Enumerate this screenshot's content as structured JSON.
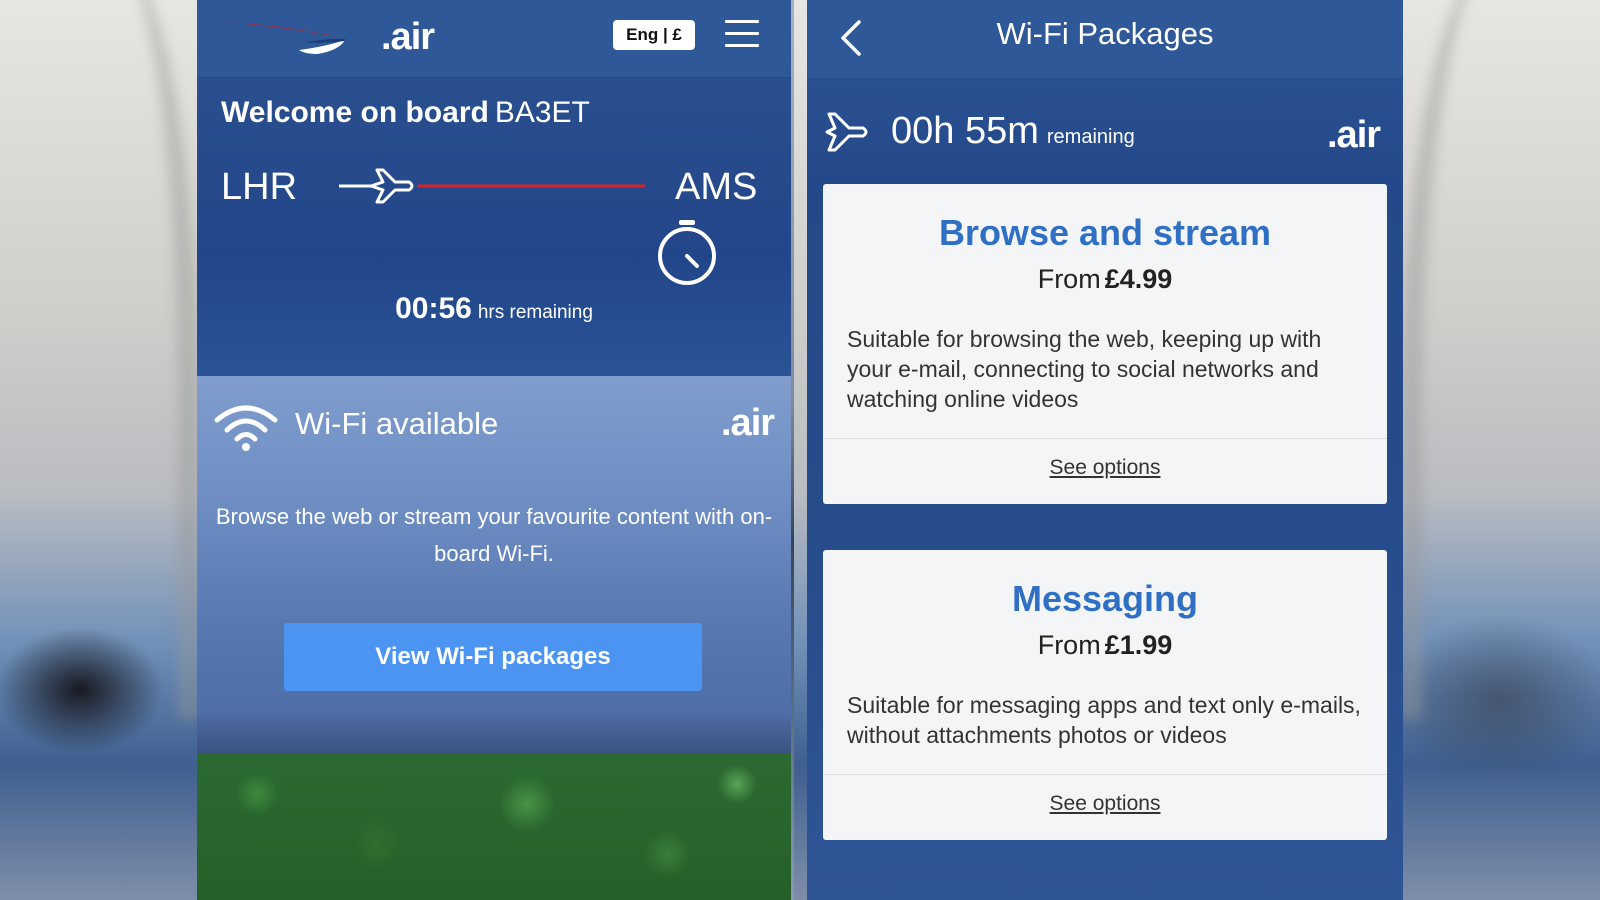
{
  "left_screen": {
    "brand": ".air",
    "language_currency": "Eng | £",
    "welcome_prefix": "Welcome on board",
    "flight_number": "BA3ET",
    "origin": "LHR",
    "destination": "AMS",
    "time_remaining": "00:56",
    "time_remaining_suffix": "hrs remaining",
    "wifi_status": "Wi-Fi available",
    "wifi_brand": ".air",
    "wifi_description": "Browse the web or stream your favourite content with on-board Wi-Fi.",
    "cta_label": "View Wi-Fi packages",
    "route_line_color": "#d8232a",
    "button_color": "#4b94f2"
  },
  "right_screen": {
    "title": "Wi-Fi Packages",
    "time_remaining": "00h 55m",
    "time_remaining_suffix": "remaining",
    "brand": ".air",
    "packages": [
      {
        "name": "Browse and stream",
        "price_prefix": "From",
        "price": "£4.99",
        "description": "Suitable for browsing the web, keeping up with your e-mail, connecting to social networks and watching online videos",
        "link_label": "See options"
      },
      {
        "name": "Messaging",
        "price_prefix": "From",
        "price": "£1.99",
        "description": "Suitable for messaging apps and text only e-mails, without attachments photos or videos",
        "link_label": "See options"
      }
    ],
    "title_color": "#2f6fc4"
  },
  "icons": [
    "ba-speedmarque-logo",
    "menu-icon",
    "plane-icon",
    "timer-icon",
    "wifi-icon",
    "back-icon"
  ]
}
